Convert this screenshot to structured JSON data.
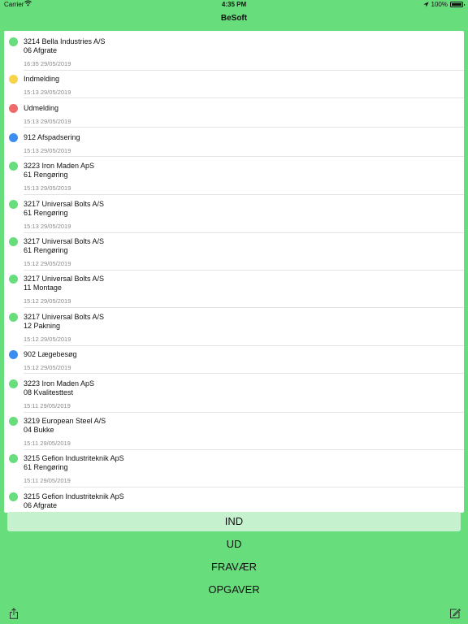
{
  "status_bar": {
    "carrier": "Carrier",
    "time": "4:35 PM",
    "battery": "100%"
  },
  "nav": {
    "title": "BeSoft"
  },
  "colors": {
    "green": "#67dd7c",
    "yellow": "#f7d44a",
    "red": "#ef6a6a",
    "blue": "#3b8ef0"
  },
  "entries": [
    {
      "status": "green",
      "line1": "3214 Bella Industries A/S",
      "line2": "06 Afgrate",
      "time": "16:35 29/05/2019"
    },
    {
      "status": "yellow",
      "line1": "Indmelding",
      "line2": "",
      "time": "15:13 29/05/2019"
    },
    {
      "status": "red",
      "line1": "Udmelding",
      "line2": "",
      "time": "15:13 29/05/2019"
    },
    {
      "status": "blue",
      "line1": "912 Afspadsering",
      "line2": "",
      "time": "15:13 29/05/2019"
    },
    {
      "status": "green",
      "line1": "3223 Iron Maden ApS",
      "line2": "61 Rengøring",
      "time": "15:13 29/05/2019"
    },
    {
      "status": "green",
      "line1": "3217 Universal Bolts A/S",
      "line2": "61 Rengøring",
      "time": "15:13 29/05/2019"
    },
    {
      "status": "green",
      "line1": "3217 Universal Bolts A/S",
      "line2": "61 Rengøring",
      "time": "15:12 29/05/2019"
    },
    {
      "status": "green",
      "line1": "3217 Universal Bolts A/S",
      "line2": "11 Montage",
      "time": "15:12 29/05/2019"
    },
    {
      "status": "green",
      "line1": "3217 Universal Bolts A/S",
      "line2": "12 Pakning",
      "time": "15:12 29/05/2019"
    },
    {
      "status": "blue",
      "line1": "902 Lægebesøg",
      "line2": "",
      "time": "15:12 29/05/2019"
    },
    {
      "status": "green",
      "line1": "3223 Iron Maden ApS",
      "line2": "08 Kvalitesttest",
      "time": "15:11 29/05/2019"
    },
    {
      "status": "green",
      "line1": "3219 European Steel A/S",
      "line2": "04 Bukke",
      "time": "15:11 29/05/2019"
    },
    {
      "status": "green",
      "line1": "3215 Gefion Industriteknik ApS",
      "line2": "61 Rengøring",
      "time": "15:11 29/05/2019"
    },
    {
      "status": "green",
      "line1": "3215 Gefion Industriteknik ApS",
      "line2": "06 Afgrate",
      "time": ""
    }
  ],
  "buttons": {
    "ind": "IND",
    "ud": "UD",
    "fravaer": "FRAVÆR",
    "opgaver": "OPGAVER"
  },
  "toolbar": {
    "share_icon": "share-icon",
    "compose_icon": "compose-icon"
  }
}
